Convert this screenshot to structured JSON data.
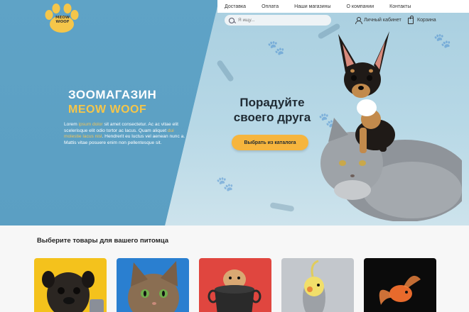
{
  "brand": {
    "logo_line1": "MEOW",
    "logo_line2": "WOOF"
  },
  "nav": {
    "items": [
      {
        "label": "Доставка"
      },
      {
        "label": "Оплата"
      },
      {
        "label": "Наши магазины"
      },
      {
        "label": "О компании"
      },
      {
        "label": "Контакты"
      }
    ]
  },
  "search": {
    "placeholder": "Я ищу..."
  },
  "account": {
    "label": "Личный кабинет"
  },
  "cart": {
    "label": "Корзина"
  },
  "hero": {
    "title": "ЗООМАГАЗИН",
    "brand": "MEOW WOOF",
    "lorem_parts": [
      "Lorem ",
      "ipsum dolor",
      " sit amet consectetur. Ac ac vitae elit scelerisque elit odio tortor ac lacus. Quam aliquet ",
      "dui molestie lacus nisl",
      ". Hendrerit eu luctus vel aenean nunc a. Mattis vitae posuere enim non pellentesque sit."
    ],
    "tagline_line1": "Порадуйте",
    "tagline_line2": "своего друга",
    "cta_label": "Выбрать из каталога"
  },
  "section": {
    "title_plain": "Выберите товары ",
    "title_bold": "для вашего питомца"
  },
  "categories": [
    {
      "icon": "pug-photo",
      "color": "#f4c21c"
    },
    {
      "icon": "cat-photo",
      "color": "#2a7fd0"
    },
    {
      "icon": "hamster-photo",
      "color": "#e0463f"
    },
    {
      "icon": "parrot-photo",
      "color": "#b9bdc3"
    },
    {
      "icon": "goldfish-photo",
      "color": "#0b0b0b"
    }
  ],
  "colors": {
    "accent": "#f6b53d",
    "hero_blue": "#5aa0c4",
    "brand_yellow": "#f5c64a"
  }
}
